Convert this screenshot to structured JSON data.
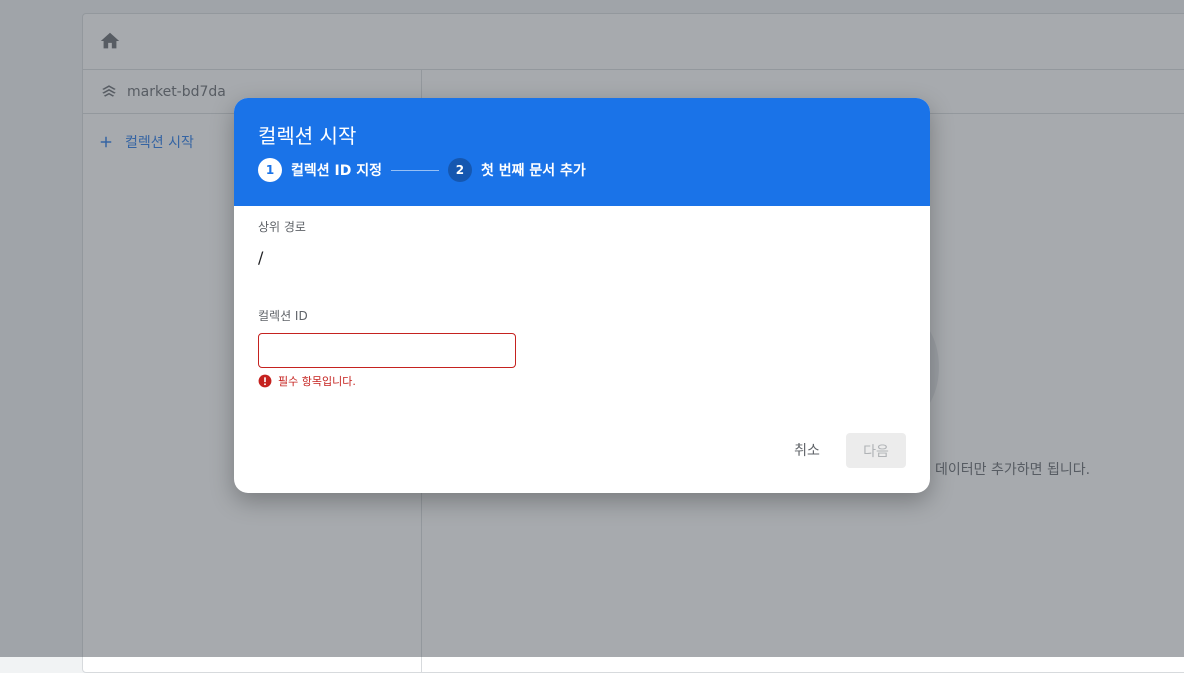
{
  "background": {
    "project_name": "market-bd7da",
    "start_collection_label": "컬렉션 시작",
    "hint_text": "데이터만 추가하면 됩니다."
  },
  "dialog": {
    "title": "컬렉션 시작",
    "steps": [
      {
        "number": "1",
        "label": "컬렉션 ID 지정",
        "state": "active"
      },
      {
        "number": "2",
        "label": "첫 번째 문서 추가",
        "state": "inactive"
      }
    ],
    "parent_path_label": "상위 경로",
    "parent_path_value": "/",
    "collection_id_label": "컬렉션 ID",
    "collection_id_value": "",
    "error_text": "필수 항목입니다.",
    "cancel_label": "취소",
    "next_label": "다음"
  },
  "colors": {
    "accent": "#1a73e8",
    "error": "#c5221f"
  },
  "icons": [
    "home-icon",
    "stack-icon",
    "plus-icon",
    "error-icon"
  ]
}
